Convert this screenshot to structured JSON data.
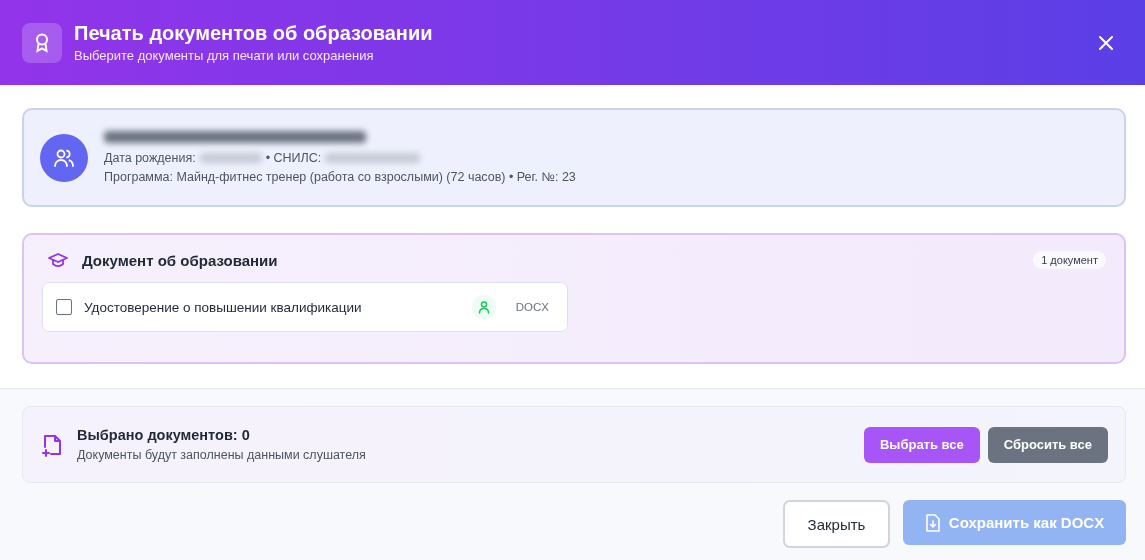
{
  "dialog": {
    "title": "Печать документов об образовании",
    "subtitle": "Выберите документы для печати или сохранения"
  },
  "student": {
    "birth_label": "Дата рождения:",
    "snils_label": "• СНИЛС:",
    "program": "Программа: Майнд-фитнес тренер (работа со взрослыми) (72 часов) • Рег. №: 23"
  },
  "section": {
    "title": "Документ об образовании",
    "count": "1 документ",
    "documents": [
      {
        "name": "Удостоверение о повышении квалификации",
        "checked": false,
        "format": "DOCX"
      }
    ]
  },
  "summary": {
    "title": "Выбрано документов: 0",
    "note": "Документы будут заполнены данными слушателя",
    "buttons": [
      "Выбрать все",
      "Сбросить все"
    ]
  },
  "footer": {
    "close": "Закрыть",
    "save": {
      "label": "Сохранить как DOCX",
      "disabled": true
    }
  }
}
